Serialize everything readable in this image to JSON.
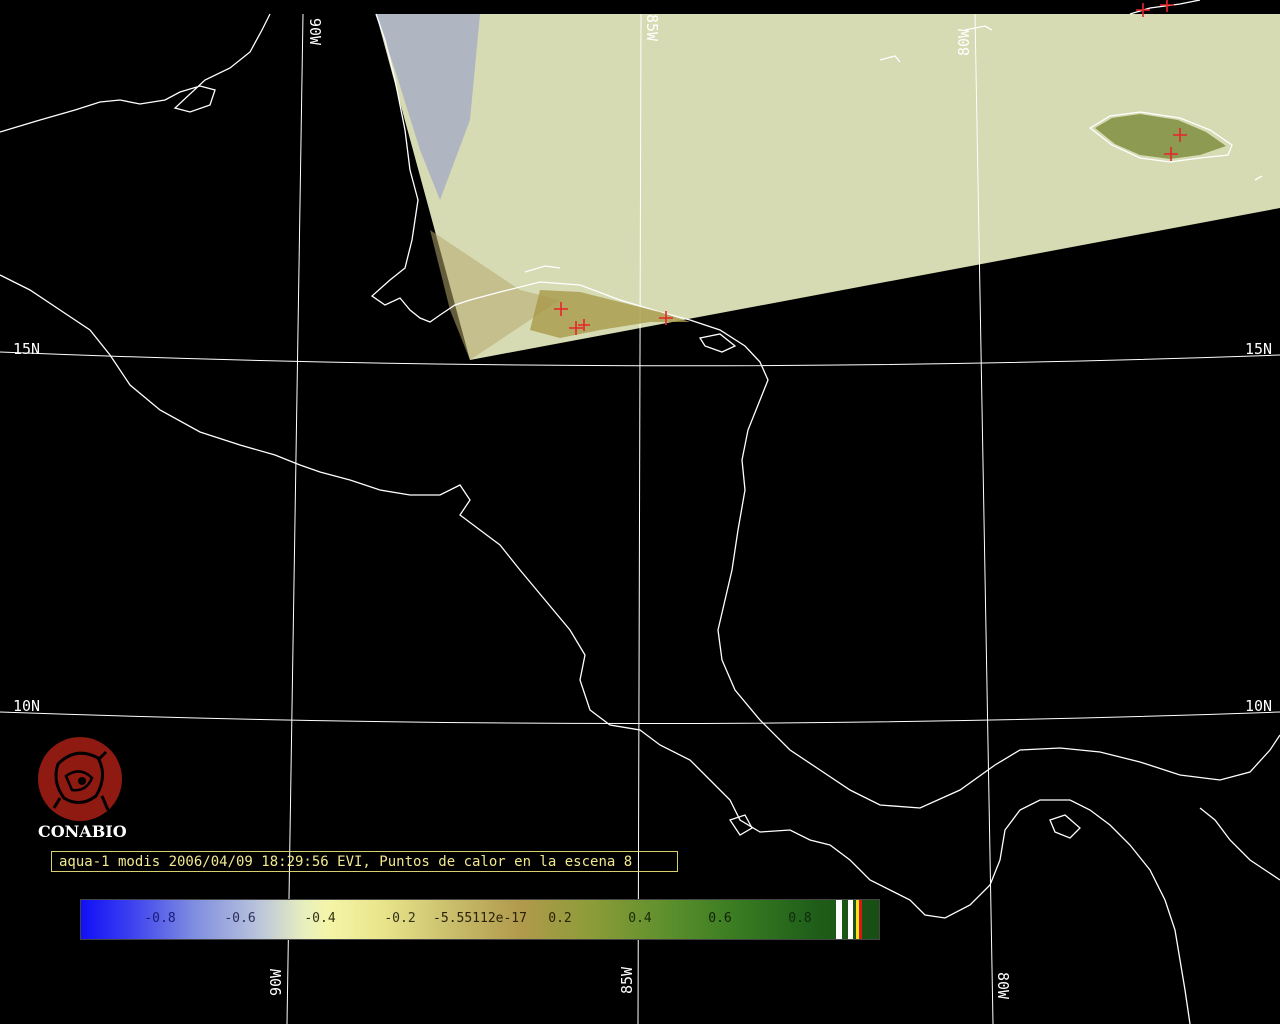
{
  "map": {
    "lat_labels": [
      "15N",
      "10N"
    ],
    "lon_labels": [
      "90W",
      "85W",
      "80W"
    ],
    "hotspot_color": "#e8242a",
    "coast_color": "#ffffff",
    "grid_color": "#ffffff",
    "scene_color": "#d6dbb3"
  },
  "logo": {
    "icon": "conabio-seal-icon",
    "text": "CONABIO",
    "color": "#8e1a12"
  },
  "caption": "aqua-1 modis 2006/04/09 18:29:56 EVI, Puntos de calor en la escena 8",
  "colorbar": {
    "ticks": [
      "-0.8",
      "-0.6",
      "-0.4",
      "-0.2",
      "-5.55112e-17",
      "0.2",
      "0.4",
      "0.6",
      "0.8"
    ],
    "min_color": "#1010f5",
    "max_color": "#184e14"
  }
}
